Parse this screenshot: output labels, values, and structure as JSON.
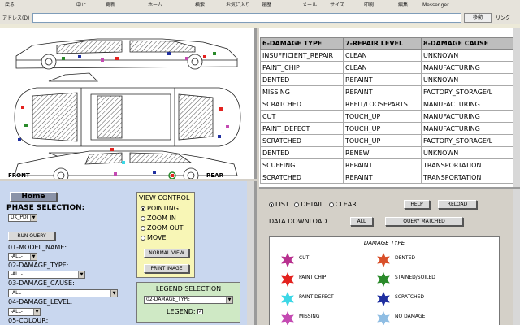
{
  "toolbar": {
    "buttons": [
      "戻る",
      "中止",
      "更新",
      "ホーム",
      "検索",
      "お気に入り",
      "履歴",
      "メール",
      "サイズ",
      "印刷",
      "編集",
      "Messenger"
    ]
  },
  "address": {
    "label": "アドレス(D)",
    "value": "",
    "go": "移動",
    "links": "リンク"
  },
  "car": {
    "front": "FRONT",
    "rear": "REAR"
  },
  "table": {
    "headers": [
      "6-DAMAGE TYPE",
      "7-REPAIR LEVEL",
      "8-DAMAGE CAUSE"
    ],
    "rows": [
      [
        "INSUFFICIENT_REPAIR",
        "CLEAN",
        "UNKNOWN"
      ],
      [
        "PAINT_CHIP",
        "CLEAN",
        "MANUFACTURING"
      ],
      [
        "DENTED",
        "REPAINT",
        "UNKNOWN"
      ],
      [
        "MISSING",
        "REPAINT",
        "FACTORY_STORAGE/L"
      ],
      [
        "SCRATCHED",
        "REFIT/LOOSEPARTS",
        "MANUFACTURING"
      ],
      [
        "CUT",
        "TOUCH_UP",
        "MANUFACTURING"
      ],
      [
        "PAINT_DEFECT",
        "TOUCH_UP",
        "MANUFACTURING"
      ],
      [
        "SCRATCHED",
        "TOUCH_UP",
        "FACTORY_STORAGE/L"
      ],
      [
        "DENTED",
        "RENEW",
        "UNKNOWN"
      ],
      [
        "SCUFFING",
        "REPAINT",
        "TRANSPORTATION"
      ],
      [
        "SCRATCHED",
        "REPAINT",
        "TRANSPORTATION"
      ]
    ]
  },
  "controls": {
    "home": "Home",
    "phase_label": "PHASE SELECTION:",
    "phase_value": "UK_PDI",
    "run_query": "RUN QUERY",
    "model_label": "01-MODEL_NAME:",
    "damage_type_label": "02-DAMAGE_TYPE:",
    "damage_cause_label": "03-DAMAGE_CAUSE:",
    "damage_level_label": "04-DAMAGE_LEVEL:",
    "colour_label": "05-COLOUR:",
    "all": "-ALL-",
    "view_control": {
      "title": "VIEW CONTROL",
      "options": [
        "POINTING",
        "ZOOM IN",
        "ZOOM OUT",
        "MOVE"
      ],
      "selected": 0,
      "normal_view": "NORMAL VIEW",
      "print_image": "PRINT IMAGE"
    },
    "legend_selection": {
      "title": "LEGEND SELECTION",
      "value": "02-DAMAGE_TYPE",
      "legend_label": "LEGEND:",
      "legend_checked": true
    }
  },
  "right": {
    "options": [
      "LIST",
      "DETAIL",
      "CLEAR"
    ],
    "selected": 0,
    "help": "HELP",
    "reload": "RELOAD",
    "download_label": "DATA DOWNLOAD",
    "all_btn": "ALL",
    "query_matched": "QUERY MATCHED",
    "legend_title": "DAMAGE TYPE",
    "legend": [
      {
        "label": "CUT",
        "color": "#b8318f"
      },
      {
        "label": "DENTED",
        "color": "#d9502a"
      },
      {
        "label": "PAINT CHIP",
        "color": "#e3221f"
      },
      {
        "label": "STAINED/SOILED",
        "color": "#2a8a2a"
      },
      {
        "label": "PAINT DEFECT",
        "color": "#3cd7e6"
      },
      {
        "label": "SCRATCHED",
        "color": "#1f2fa0"
      },
      {
        "label": "MISSING",
        "color": "#c44ab2"
      },
      {
        "label": "NO DAMAGE",
        "color": "#8fbde3"
      }
    ]
  }
}
